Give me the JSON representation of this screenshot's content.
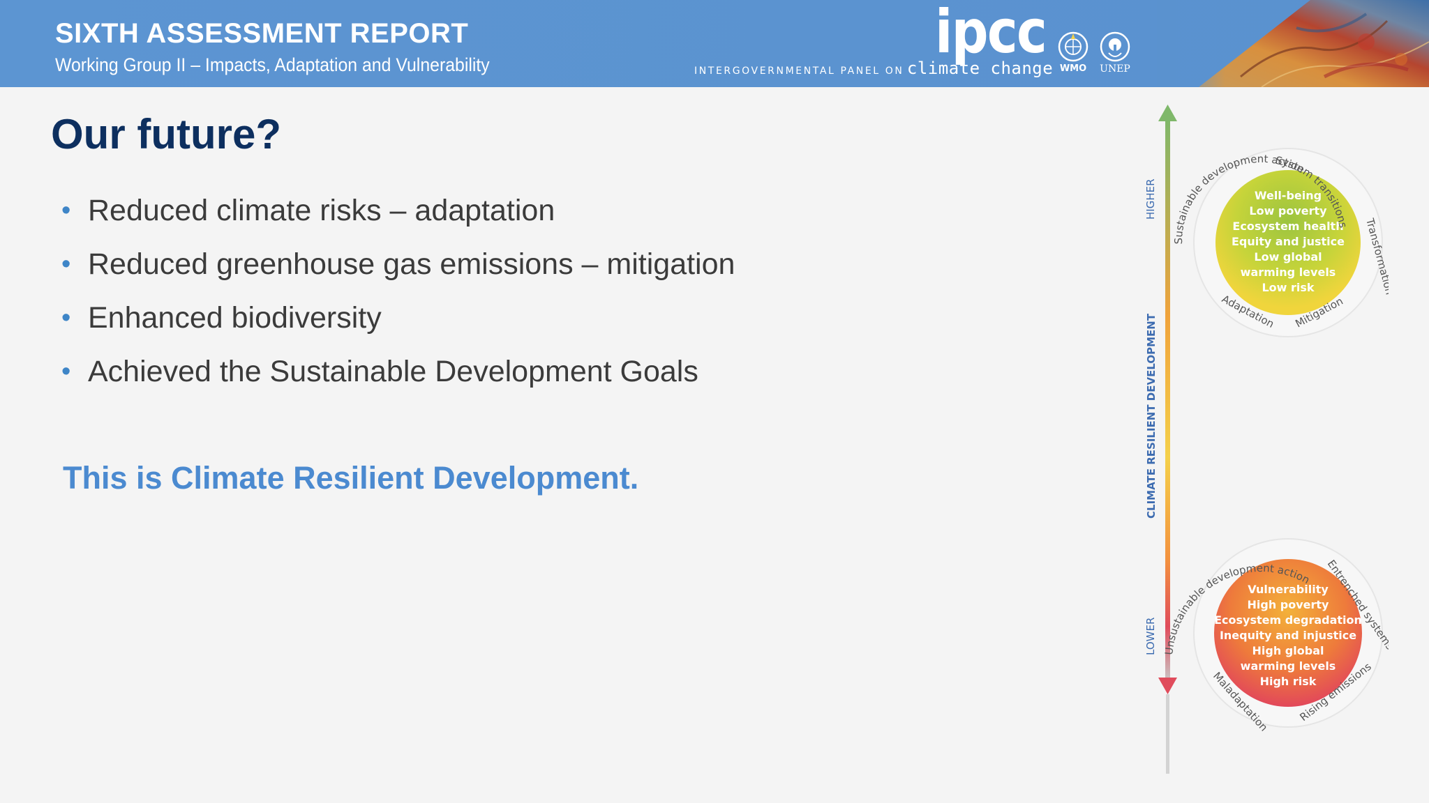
{
  "header": {
    "report_title": "SIXTH ASSESSMENT REPORT",
    "working_group": "Working Group II – Impacts, Adaptation and Vulnerability",
    "ipcc_logo_text": "ipcc",
    "ipcc_tagline_small": "INTERGOVERNMENTAL PANEL ON",
    "ipcc_tagline_big": "climate change",
    "wmo_label": "WMO",
    "unep_label": "UNEP",
    "icons": [
      "wmo-logo-icon",
      "unep-logo-icon",
      "satellite-image"
    ]
  },
  "slide": {
    "title": "Our future?",
    "bullets": [
      "Reduced climate risks – adaptation",
      "Reduced greenhouse gas emissions – mitigation",
      "Enhanced biodiversity",
      "Achieved the Sustainable Development Goals"
    ],
    "closing": "This is Climate Resilient Development."
  },
  "figure": {
    "axis_label": "CLIMATE RESILIENT DEVELOPMENT",
    "higher_label": "HIGHER",
    "lower_label": "LOWER",
    "top_circle": {
      "lines": [
        "Well-being",
        "Low poverty",
        "Ecosystem health",
        "Equity and justice",
        "Low global",
        "warming levels",
        "Low risk"
      ],
      "ring_labels": [
        "Sustainable development action",
        "System transitions",
        "Transformation",
        "Mitigation",
        "Adaptation"
      ]
    },
    "bottom_circle": {
      "lines": [
        "Vulnerability",
        "High poverty",
        "Ecosystem degradation",
        "Inequity and injustice",
        "High global",
        "warming levels",
        "High risk"
      ],
      "ring_labels": [
        "Unsustainable development action",
        "Entrenched systems",
        "Rising emissions",
        "Maladaptation"
      ]
    },
    "colors": {
      "arrow_top": "#7fb86a",
      "arrow_mid": "#f0a33c",
      "arrow_bottom": "#e04c5c",
      "axis_text": "#3c6bb0"
    }
  },
  "colors": {
    "banner": "#5a93d0",
    "title": "#0d2f5f",
    "bullet_dot": "#3e85c7",
    "closing": "#4b8ad0"
  }
}
